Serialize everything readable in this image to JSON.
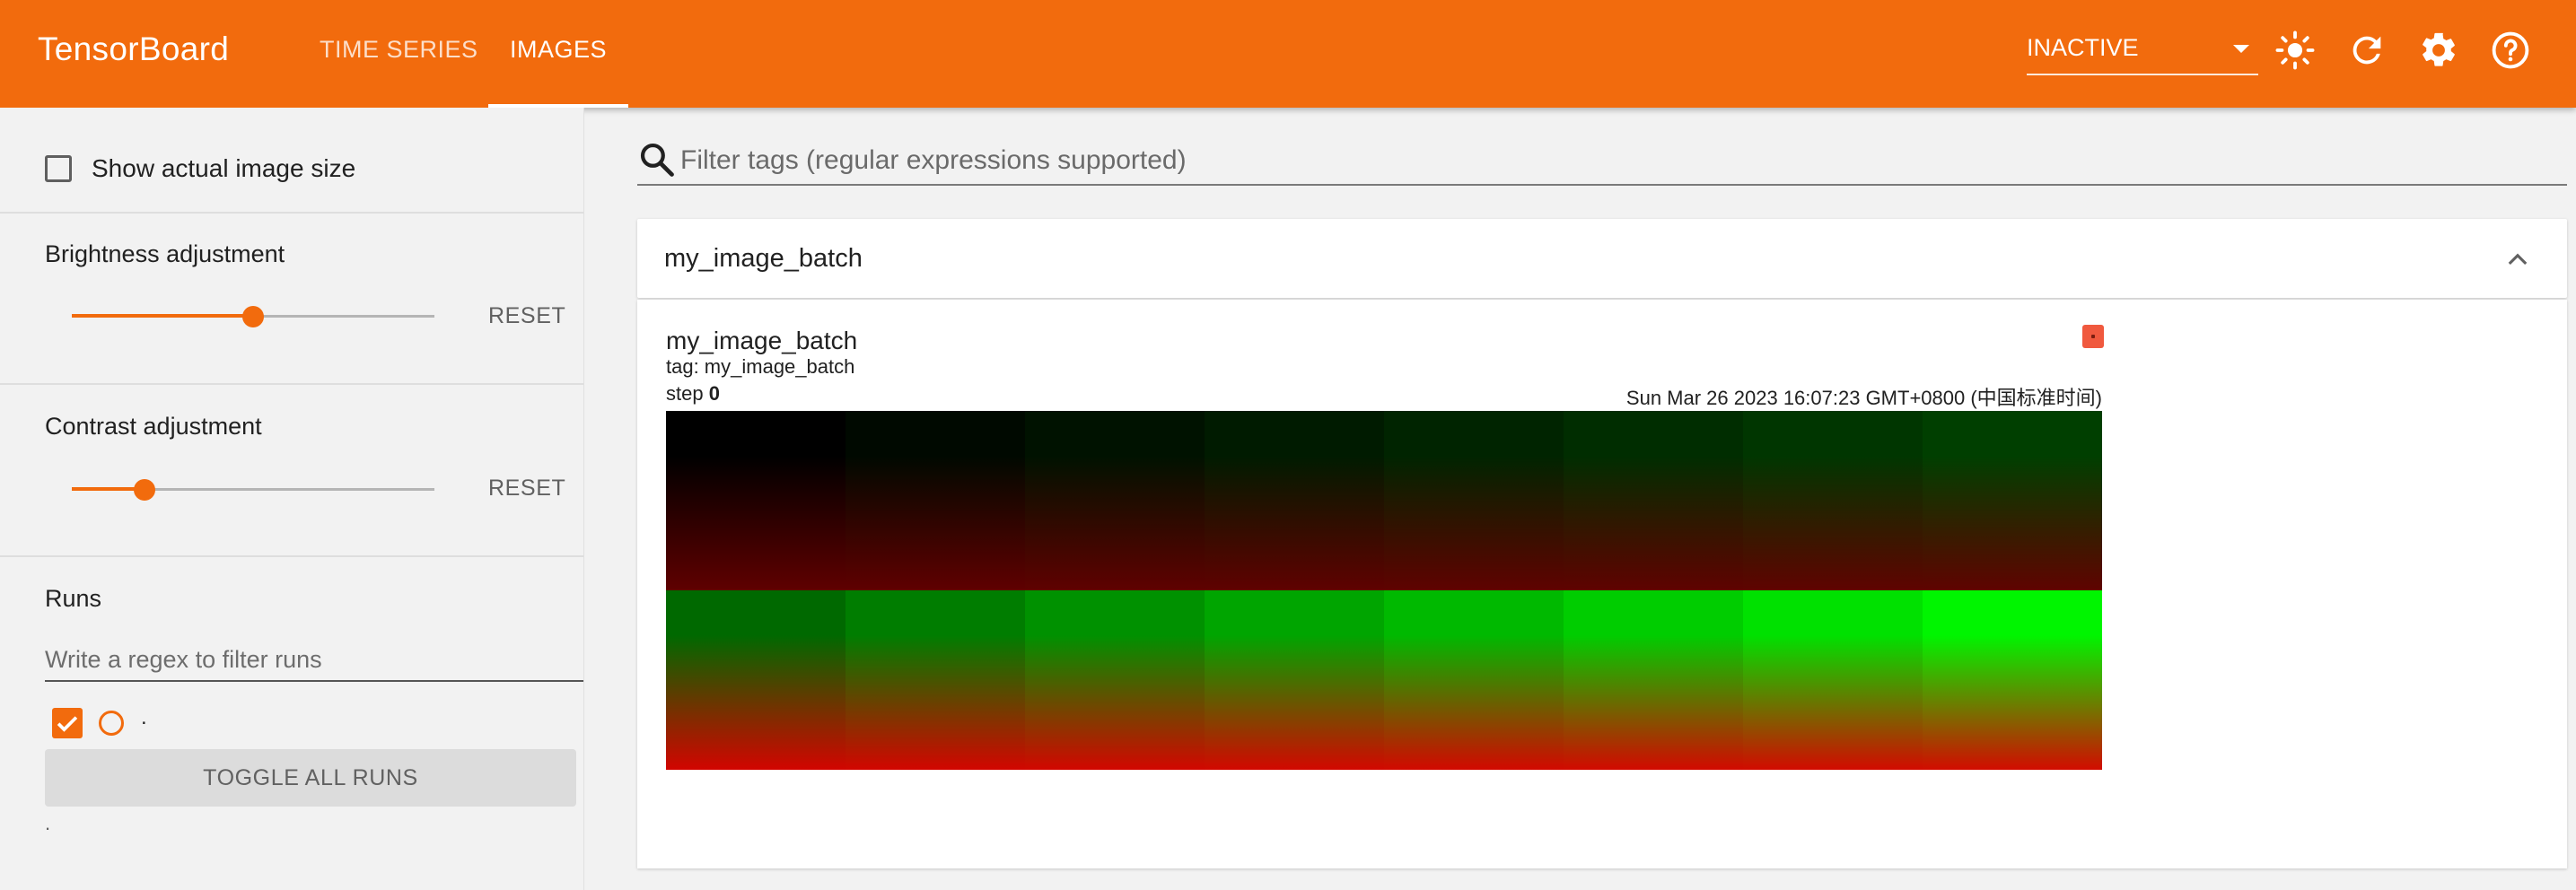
{
  "header": {
    "brand": "TensorBoard",
    "tabs": [
      {
        "label": "TIME SERIES",
        "active": false
      },
      {
        "label": "IMAGES",
        "active": true
      }
    ],
    "reload_select": "INACTIVE",
    "icons": [
      "theme-sun-icon",
      "reload-icon",
      "settings-gear-icon",
      "help-icon"
    ]
  },
  "sidebar": {
    "show_actual_size_label": "Show actual image size",
    "brightness": {
      "label": "Brightness adjustment",
      "reset_label": "RESET",
      "value": 0.5
    },
    "contrast": {
      "label": "Contrast adjustment",
      "reset_label": "RESET",
      "value": 0.2
    },
    "runs": {
      "title": "Runs",
      "filter_placeholder": "Write a regex to filter runs",
      "items": [
        {
          "name": ".",
          "checked": true,
          "color": "#f26b0d"
        }
      ],
      "toggle_all_label": "TOGGLE ALL RUNS",
      "footer": "."
    }
  },
  "main": {
    "tag_filter_placeholder": "Filter tags (regular expressions supported)",
    "group": {
      "title": "my_image_batch",
      "expanded": true
    },
    "card": {
      "title": "my_image_batch",
      "tag_line": "tag: my_image_batch",
      "step_label": "step ",
      "step_value": "0",
      "timestamp": "Sun Mar 26 2023 16:07:23 GMT+0800 (中国标准时间)",
      "image_tiles_per_row": 8,
      "image_rows": 2
    }
  },
  "colors": {
    "accent": "#f26b0d",
    "header_bg": "#f26b0d",
    "fullscreen_button": "#f0593e"
  }
}
